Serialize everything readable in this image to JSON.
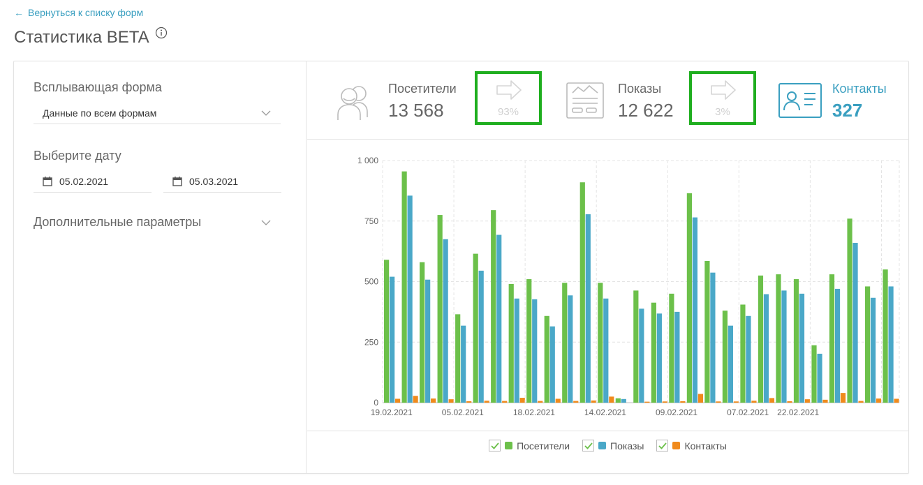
{
  "header": {
    "back_link": "Вернуться к списку форм",
    "title": "Статистика BETA"
  },
  "filters": {
    "form_label": "Всплывающая форма",
    "form_value": "Данные по всем формам",
    "date_label": "Выберите дату",
    "date_from": "05.02.2021",
    "date_to": "05.03.2021",
    "extra_params": "Дополнительные параметры"
  },
  "stats": {
    "visitors_label": "Посетители",
    "visitors_value": "13 568",
    "conv1": "93%",
    "shows_label": "Показы",
    "shows_value": "12 622",
    "conv2": "3%",
    "contacts_label": "Контакты",
    "contacts_value": "327"
  },
  "colors": {
    "visitors": "#6cc04a",
    "shows": "#4aa8c8",
    "contacts": "#f08a1c",
    "highlight": "#1fae1f",
    "accent": "#3a9fc0"
  },
  "legend": {
    "visitors": "Посетители",
    "shows": "Показы",
    "contacts": "Контакты"
  },
  "chart_data": {
    "type": "bar",
    "ylim": [
      0,
      1000
    ],
    "yticks": [
      "0",
      "250",
      "500",
      "750",
      "1 000"
    ],
    "xticks": [
      "19.02.2021",
      "05.02.2021",
      "18.02.2021",
      "14.02.2021",
      "09.02.2021",
      "07.02.2021",
      "22.02.2021"
    ],
    "grid": true,
    "series": [
      {
        "name": "Посетители",
        "values": [
          590,
          955,
          580,
          775,
          365,
          615,
          795,
          490,
          510,
          358,
          495,
          910,
          495,
          18,
          463,
          413,
          450,
          865,
          585,
          380,
          405,
          525,
          530,
          510,
          237,
          530,
          760,
          480,
          550
        ]
      },
      {
        "name": "Показы",
        "values": [
          520,
          855,
          508,
          675,
          318,
          545,
          693,
          430,
          427,
          315,
          443,
          778,
          430,
          15,
          388,
          368,
          375,
          765,
          537,
          318,
          358,
          448,
          463,
          450,
          202,
          470,
          660,
          433,
          480
        ]
      },
      {
        "name": "Контакты",
        "values": [
          16,
          28,
          17,
          14,
          6,
          8,
          7,
          20,
          7,
          16,
          7,
          9,
          25,
          0,
          4,
          5,
          6,
          36,
          5,
          5,
          8,
          19,
          6,
          14,
          12,
          40,
          7,
          17,
          16
        ]
      }
    ]
  }
}
